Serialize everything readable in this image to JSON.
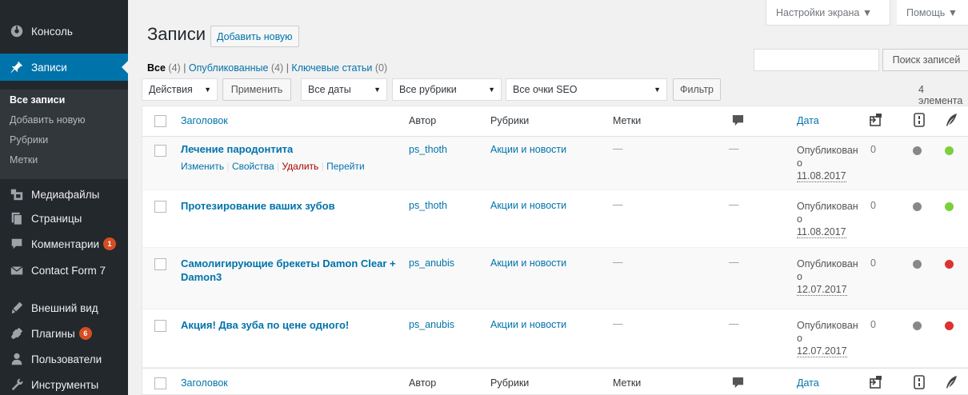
{
  "sidebar": {
    "items": [
      {
        "label": "Консоль",
        "icon": "dashboard-icon"
      },
      {
        "label": "Записи",
        "icon": "pin-icon"
      },
      {
        "label": "Медиафайлы",
        "icon": "media-icon"
      },
      {
        "label": "Страницы",
        "icon": "pages-icon"
      },
      {
        "label": "Комментарии",
        "icon": "comments-icon",
        "badge": "1"
      },
      {
        "label": "Contact Form 7",
        "icon": "mail-icon"
      },
      {
        "label": "Внешний вид",
        "icon": "appearance-icon"
      },
      {
        "label": "Плагины",
        "icon": "plugins-icon",
        "badge": "6"
      },
      {
        "label": "Пользователи",
        "icon": "users-icon"
      },
      {
        "label": "Инструменты",
        "icon": "tools-icon"
      }
    ],
    "submenu": [
      "Все записи",
      "Добавить новую",
      "Рубрики",
      "Метки"
    ]
  },
  "screen_meta": {
    "screen_options": "Настройки экрана ▼",
    "help": "Помощь ▼"
  },
  "header": {
    "title": "Записи",
    "add_new": "Добавить новую"
  },
  "filters": {
    "all": "Все",
    "all_count": "(4)",
    "published": "Опубликованные",
    "published_count": "(4)",
    "cornerstone": "Ключевые статьи",
    "cornerstone_count": "(0)",
    "separator": "|"
  },
  "search": {
    "value": "",
    "button": "Поиск записей"
  },
  "tablenav": {
    "bulk_action": "Действия",
    "apply": "Применить",
    "dates": "Все даты",
    "categories": "Все рубрики",
    "seo": "Все очки SEO",
    "filter": "Фильтр",
    "items_count": "4 элемента"
  },
  "columns": {
    "title": "Заголовок",
    "author": "Автор",
    "categories": "Рубрики",
    "tags": "Метки",
    "date": "Дата"
  },
  "row_actions": {
    "edit": "Изменить",
    "quick_edit": "Свойства",
    "trash": "Удалить",
    "view": "Перейти",
    "sep": "|"
  },
  "posts": [
    {
      "title": "Лечение пародонтита",
      "author": "ps_thoth",
      "category": "Акции и новости",
      "tags": "—",
      "comments": "—",
      "status_line1": "Опубликован",
      "status_line2": "о",
      "date": "11.08.2017",
      "links": "0",
      "seo_color": "#888888",
      "readability_color": "#7ad03a"
    },
    {
      "title": "Протезирование ваших зубов",
      "author": "ps_thoth",
      "category": "Акции и новости",
      "tags": "—",
      "comments": "—",
      "status_line1": "Опубликован",
      "status_line2": "о",
      "date": "11.08.2017",
      "links": "0",
      "seo_color": "#888888",
      "readability_color": "#7ad03a"
    },
    {
      "title_line1": "Самолигирующие брекеты Damon Clear +",
      "title_line2": "Damon3",
      "author": "ps_anubis",
      "category": "Акции и новости",
      "tags": "—",
      "comments": "—",
      "status_line1": "Опубликован",
      "status_line2": "о",
      "date": "12.07.2017",
      "links": "0",
      "seo_color": "#888888",
      "readability_color": "#dc3232"
    },
    {
      "title": "Акция! Два зуба по цене одного!",
      "author": "ps_anubis",
      "category": "Акции и новости",
      "tags": "—",
      "comments": "—",
      "status_line1": "Опубликован",
      "status_line2": "о",
      "date": "12.07.2017",
      "links": "0",
      "seo_color": "#888888",
      "readability_color": "#dc3232"
    }
  ],
  "colors": {
    "sidebar_bg": "#23282d",
    "accent": "#0073aa",
    "badge": "#d54e21"
  }
}
